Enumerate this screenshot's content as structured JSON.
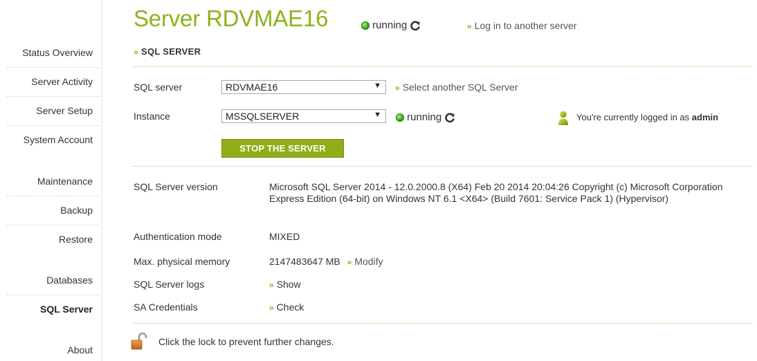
{
  "sidebar": {
    "items": [
      {
        "label": "Status Overview"
      },
      {
        "label": "Server Activity"
      },
      {
        "label": "Server Setup"
      },
      {
        "label": "System Account"
      },
      {
        "label": "Maintenance"
      },
      {
        "label": "Backup"
      },
      {
        "label": "Restore"
      },
      {
        "label": "Databases"
      },
      {
        "label": "SQL Server",
        "active": true
      },
      {
        "label": "About"
      }
    ]
  },
  "header": {
    "title": "Server RDVMAE16",
    "status": "running",
    "login_link": "Log in to another server"
  },
  "section": {
    "title": "SQL SERVER"
  },
  "form": {
    "sql_server_label": "SQL server",
    "sql_server_value": "RDVMAE16",
    "select_another": "Select another SQL Server",
    "instance_label": "Instance",
    "instance_value": "MSSQLSERVER",
    "instance_status": "running",
    "logged_prefix": "You're currently logged in as",
    "logged_user": "admin",
    "stop_button": "STOP THE SERVER"
  },
  "info": {
    "version_label": "SQL Server version",
    "version_value": "Microsoft SQL Server 2014 - 12.0.2000.8 (X64) Feb 20 2014 20:04:26 Copyright (c) Microsoft Corporation Express Edition (64-bit) on Windows NT 6.1 <X64> (Build 7601: Service Pack 1) (Hypervisor)",
    "auth_label": "Authentication mode",
    "auth_value": "MIXED",
    "memory_label": "Max. physical memory",
    "memory_value": "2147483647 MB",
    "memory_link": "Modify",
    "logs_label": "SQL Server logs",
    "logs_link": "Show",
    "sa_label": "SA Credentials",
    "sa_link": "Check"
  },
  "footer": {
    "lock_text": "Click the lock to prevent further changes."
  },
  "colors": {
    "accent": "#8db31b",
    "button": "#90ae1a",
    "status_green": "#39b11a"
  },
  "icons": [
    "refresh-icon",
    "status-dot-icon",
    "user-icon",
    "lock-icon"
  ]
}
